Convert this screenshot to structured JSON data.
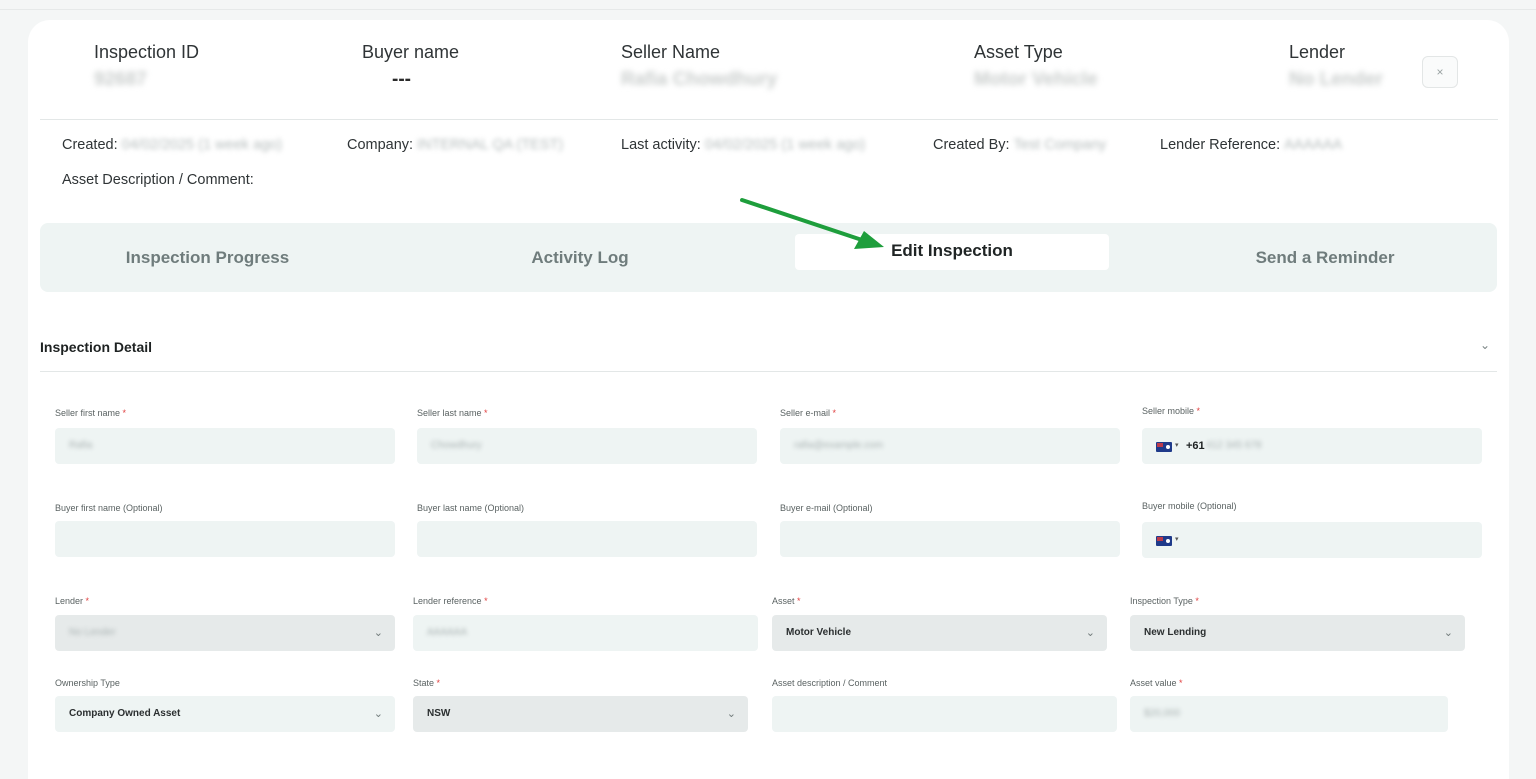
{
  "header": {
    "columns": [
      {
        "label": "Inspection ID",
        "value": "92687"
      },
      {
        "label": "Buyer name",
        "value": "---"
      },
      {
        "label": "Seller Name",
        "value": "Rafia Chowdhury"
      },
      {
        "label": "Asset Type",
        "value": "Motor Vehicle"
      },
      {
        "label": "Lender",
        "value": "No Lender"
      }
    ],
    "close_label": "×"
  },
  "meta": {
    "created_label": "Created:",
    "created_value": "04/02/2025 (1 week ago)",
    "company_label": "Company:",
    "company_value": "INTERNAL QA (TEST)",
    "last_activity_label": "Last activity:",
    "last_activity_value": "04/02/2025 (1 week ago)",
    "created_by_label": "Created By:",
    "created_by_value": "Test Company",
    "lender_reference_label": "Lender Reference:",
    "lender_reference_value": "AAAAAA",
    "asset_description_label": "Asset Description / Comment:"
  },
  "tabs": [
    {
      "label": "Inspection Progress",
      "active": false
    },
    {
      "label": "Activity Log",
      "active": false
    },
    {
      "label": "Edit Inspection",
      "active": true
    },
    {
      "label": "Send a Reminder",
      "active": false
    }
  ],
  "annotation": {
    "arrow_color": "#1e9e3c"
  },
  "section": {
    "title": "Inspection Detail",
    "chevron": "⌄"
  },
  "form": {
    "seller_first_name": {
      "label": "Seller first name",
      "required": "*",
      "value": "Rafia"
    },
    "seller_last_name": {
      "label": "Seller last name",
      "required": "*",
      "value": "Chowdhury"
    },
    "seller_email": {
      "label": "Seller e-mail",
      "required": "*",
      "value": "rafia@example.com"
    },
    "seller_mobile": {
      "label": "Seller mobile",
      "required": "*",
      "dial_code": "+61",
      "value": "412 345 678"
    },
    "buyer_first_name": {
      "label": "Buyer first name (Optional)",
      "value": ""
    },
    "buyer_last_name": {
      "label": "Buyer last name (Optional)",
      "value": ""
    },
    "buyer_email": {
      "label": "Buyer e-mail (Optional)",
      "value": ""
    },
    "buyer_mobile": {
      "label": "Buyer mobile (Optional)",
      "value": ""
    },
    "lender": {
      "label": "Lender",
      "required": "*",
      "value": "No Lender"
    },
    "lender_reference": {
      "label": "Lender reference",
      "required": "*",
      "value": "AAAAAA"
    },
    "asset": {
      "label": "Asset",
      "required": "*",
      "value": "Motor Vehicle"
    },
    "inspection_type": {
      "label": "Inspection Type",
      "required": "*",
      "value": "New Lending"
    },
    "ownership_type": {
      "label": "Ownership Type",
      "value": "Company Owned Asset"
    },
    "state": {
      "label": "State",
      "required": "*",
      "value": "NSW"
    },
    "asset_description": {
      "label": "Asset description / Comment",
      "value": ""
    },
    "asset_value": {
      "label": "Asset value",
      "required": "*",
      "value": "$20,000"
    }
  },
  "icons": {
    "dropdown": "chevron-down-icon",
    "flag": "australia-flag-icon"
  }
}
